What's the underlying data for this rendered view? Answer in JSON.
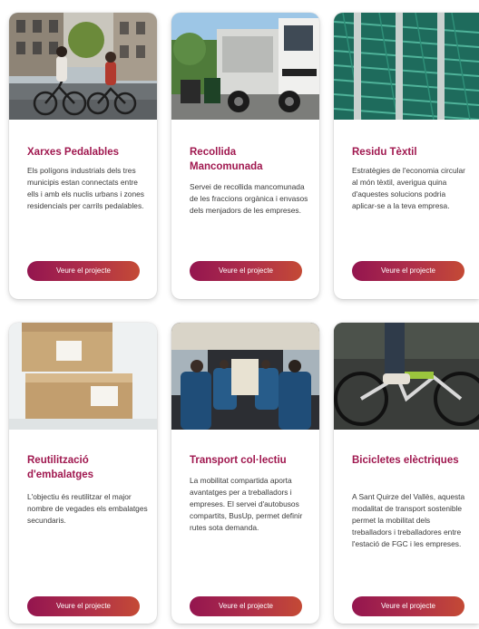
{
  "cards": [
    {
      "title": "Xarxes Pedalables",
      "description": "Els polígons industrials dels tres municipis estan connectats entre ells i amb els nuclis urbans i zones residencials per carrils pedalables.",
      "button_label": "Veure el projecte",
      "image": "cyclists-photo"
    },
    {
      "title": "Recollida Mancomunada",
      "description": "Servei de recollida mancomunada de les fraccions orgànica i envasos dels menjadors de les empreses.",
      "button_label": "Veure el projecte",
      "image": "garbage-truck-photo"
    },
    {
      "title": "Residu Tèxtil",
      "description": "Estratègies de l'economia circular al món tèxtil, averigua quina d'aquestes solucions podria aplicar-se a la teva empresa.",
      "button_label": "Veure el projecte",
      "image": "textile-rolls-photo"
    },
    {
      "title": "Reutilització d'embalatges",
      "description": "L'objectiu és reutilitzar el major nombre de vegades els embalatges secundaris.",
      "button_label": "Veure el projecte",
      "image": "cardboard-boxes-photo"
    },
    {
      "title": "Transport col·lectiu",
      "description": "La mobilitat compartida aporta avantatges per a treballadors i empreses. El servei d'autobusos compartits, BusUp, permet definir rutes sota demanda.",
      "button_label": "Veure el projecte",
      "image": "bus-interior-photo"
    },
    {
      "title": "Bicicletes elèctriques",
      "description": "A Sant Quirze del Vallès, aquesta modalitat de transport sostenible permet la mobilitat dels treballadors i treballadores entre l'estació de FGC i les empreses.",
      "button_label": "Veure el projecte",
      "image": "electric-bike-photo"
    }
  ],
  "colors": {
    "title": "#a0184f",
    "button_gradient_start": "#94154f",
    "button_gradient_end": "#c44a35"
  }
}
